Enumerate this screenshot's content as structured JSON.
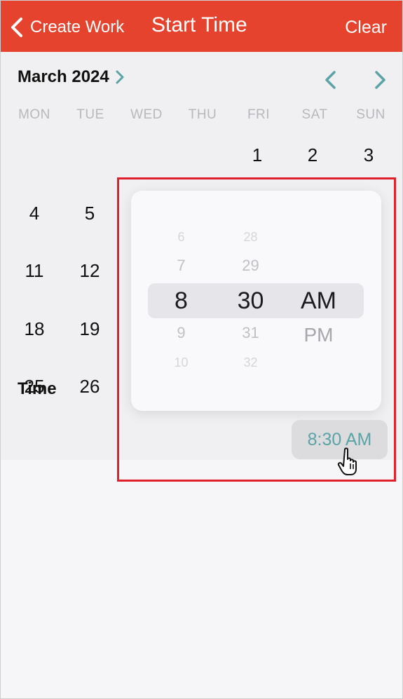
{
  "nav": {
    "back_label": "Create Work",
    "title": "Start Time",
    "clear_label": "Clear"
  },
  "colors": {
    "nav_bar": "#e5432d",
    "accent_teal": "#5aa3a6",
    "highlight_border": "#e0202b"
  },
  "calendar": {
    "month_label": "March 2024",
    "weekdays": [
      "MON",
      "TUE",
      "WED",
      "THU",
      "FRI",
      "SAT",
      "SUN"
    ],
    "week1": [
      "1",
      "2",
      "3"
    ],
    "col_mon": [
      "4",
      "11",
      "18",
      "25"
    ],
    "col_tue": [
      "5",
      "12",
      "19",
      "26"
    ]
  },
  "time_row": {
    "label": "Time",
    "value": "8:30 AM"
  },
  "picker": {
    "hours": [
      "6",
      "7",
      "8",
      "9",
      "10"
    ],
    "minutes": [
      "28",
      "29",
      "30",
      "31",
      "32"
    ],
    "ampm": [
      "AM",
      "PM"
    ],
    "selected": {
      "hour": "8",
      "minute": "30",
      "period": "AM"
    }
  },
  "icons": {
    "back": "chevron-left-icon",
    "month_expand": "chevron-right-icon",
    "prev_month": "chevron-left-icon",
    "next_month": "chevron-right-icon",
    "cursor": "hand-pointer-icon"
  }
}
